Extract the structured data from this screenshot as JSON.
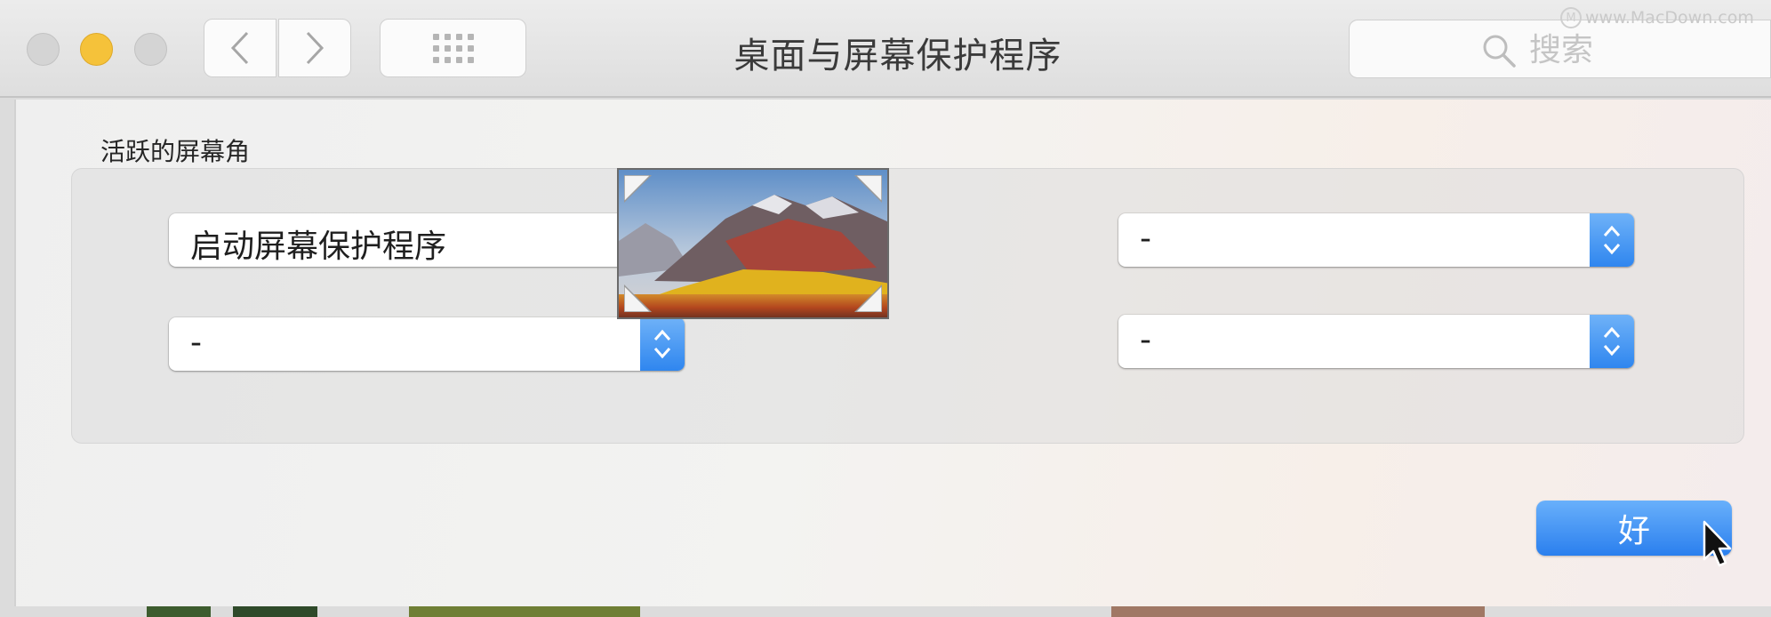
{
  "window": {
    "title": "桌面与屏幕保护程序"
  },
  "toolbar": {
    "back_icon": "chevron-left-icon",
    "forward_icon": "chevron-right-icon",
    "grid_icon": "show-all-grid-icon"
  },
  "search": {
    "placeholder": "搜索",
    "icon": "search-icon"
  },
  "watermark": {
    "text": "www.MacDown.com"
  },
  "hot_corners": {
    "group_label": "活跃的屏幕角",
    "top_left": "启动屏幕保护程序",
    "bottom_left": "-",
    "top_right": "-",
    "bottom_right": "-"
  },
  "actions": {
    "ok_label": "好"
  },
  "colors": {
    "accent_blue": "#2f86ef",
    "minimize_yellow": "#f5c23a",
    "inactive_light": "#d4d4d4"
  }
}
